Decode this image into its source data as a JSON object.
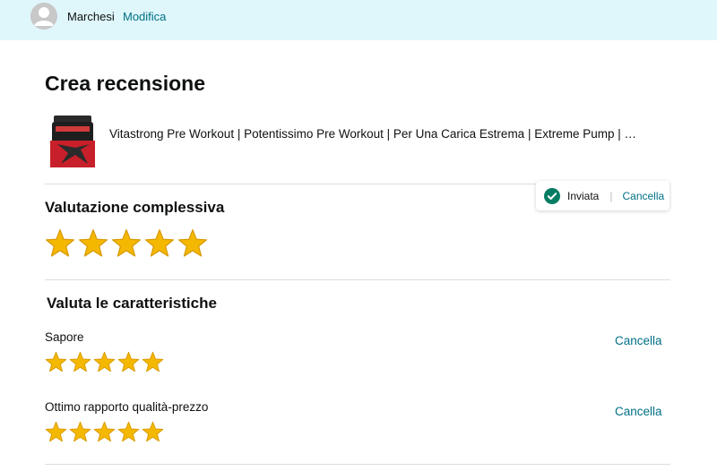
{
  "header": {
    "username": "Marchesi",
    "edit_label": "Modifica"
  },
  "page": {
    "title": "Crea recensione"
  },
  "product": {
    "name": "Vitastrong Pre Workout | Potentissimo Pre Workout | Per Una Carica Estrema | Extreme Pump | …"
  },
  "status": {
    "label": "Inviata",
    "separator": "|",
    "cancel_label": "Cancella"
  },
  "overall": {
    "title": "Valutazione complessiva",
    "rating": 5,
    "max": 5
  },
  "features": {
    "title": "Valuta le caratteristiche",
    "items": [
      {
        "label": "Sapore",
        "rating": 5,
        "max": 5,
        "cancel_label": "Cancella"
      },
      {
        "label": "Ottimo rapporto qualità-prezzo",
        "rating": 5,
        "max": 5,
        "cancel_label": "Cancella"
      }
    ]
  },
  "colors": {
    "star": "#f5b800",
    "link": "#007185",
    "check": "#067d62"
  },
  "icons": {
    "avatar": "user-avatar-icon",
    "check": "check-circle-icon",
    "star": "star-icon",
    "product": "product-image"
  }
}
